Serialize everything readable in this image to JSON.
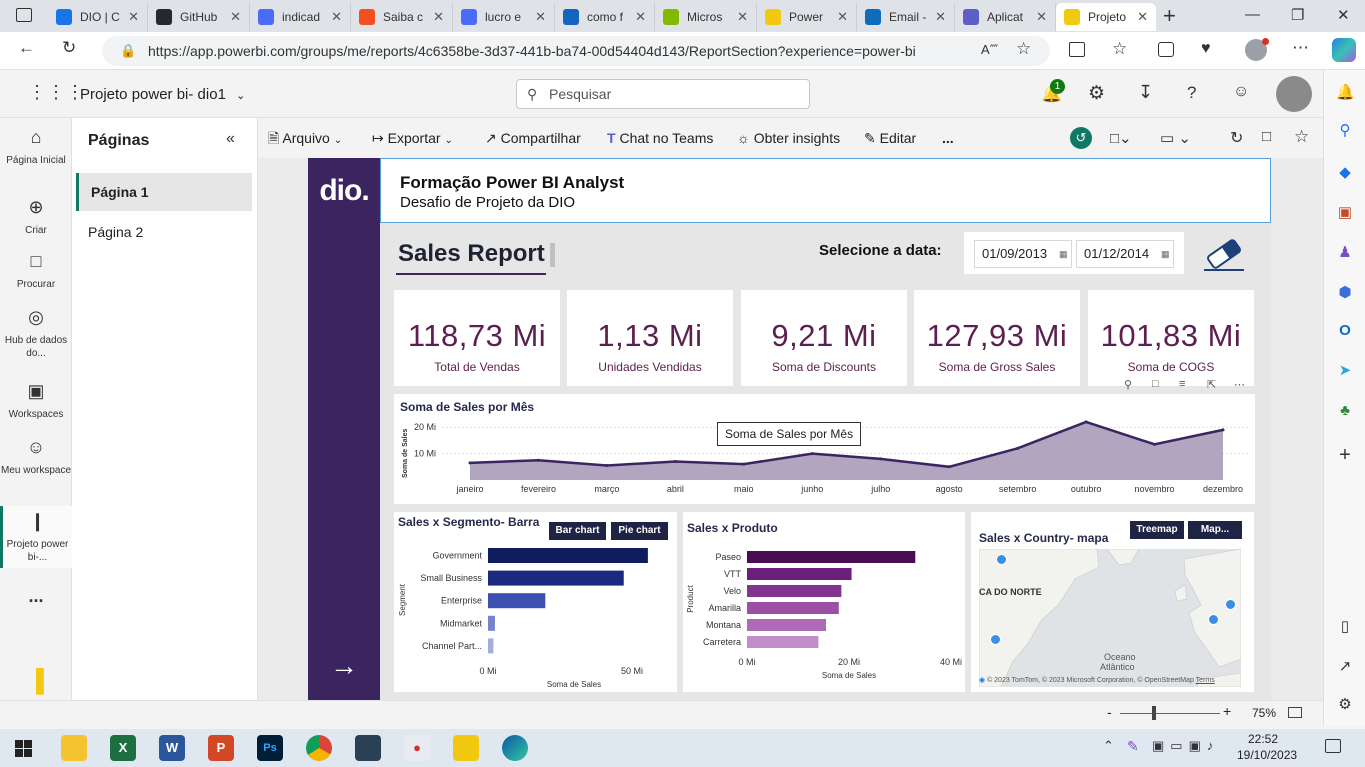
{
  "browser": {
    "tabs": [
      {
        "label": "DIO | C",
        "color": "#1a73e8"
      },
      {
        "label": "GitHub",
        "color": "#24292f"
      },
      {
        "label": "indicad",
        "color": "#4a6cf7"
      },
      {
        "label": "Saiba c",
        "color": "#f25022"
      },
      {
        "label": "lucro e",
        "color": "#4a6cf7"
      },
      {
        "label": "como f",
        "color": "#1565c0"
      },
      {
        "label": "Micros",
        "color": "#7fba00"
      },
      {
        "label": "Power",
        "color": "#f2c811"
      },
      {
        "label": "Email -",
        "color": "#0f6cbd"
      },
      {
        "label": "Aplicat",
        "color": "#5b5fc7"
      },
      {
        "label": "Projeto",
        "color": "#f2c811"
      }
    ],
    "url": "https://app.powerbi.com/groups/me/reports/4c6358be-3d37-441b-ba74-00d54404d143/ReportSection?experience=power-bi"
  },
  "pbi_header": {
    "workspace_title": "Projeto power bi- dio1",
    "search_placeholder": "Pesquisar",
    "notification_count": "1"
  },
  "left_nav": [
    {
      "label": "Página Inicial",
      "icon": "home-icon"
    },
    {
      "label": "Criar",
      "icon": "plus-circle-icon"
    },
    {
      "label": "Procurar",
      "icon": "folder-icon"
    },
    {
      "label": "Hub de dados do...",
      "icon": "data-hub-icon"
    },
    {
      "label": "Workspaces",
      "icon": "workspaces-icon"
    },
    {
      "label": "Meu workspace",
      "icon": "user-icon"
    },
    {
      "label": "Projeto power bi-...",
      "icon": "report-icon"
    },
    {
      "label": "...",
      "icon": "more-icon"
    },
    {
      "label": "Power BI",
      "icon": "powerbi-logo-icon"
    }
  ],
  "pages_pane": {
    "title": "Páginas",
    "pages": [
      "Página 1",
      "Página 2"
    ]
  },
  "toolbar": {
    "file": "Arquivo",
    "export": "Exportar",
    "share": "Compartilhar",
    "teams": "Chat no Teams",
    "insights": "Obter insights",
    "edit": "Editar",
    "more": "..."
  },
  "report": {
    "logo_text": "dio.",
    "header_title": "Formação Power BI Analyst",
    "header_subtitle": "Desafio de Projeto da DIO",
    "sales_report_title": "Sales Report",
    "date_label": "Selecione a data:",
    "date_from": "01/09/2013",
    "date_to": "01/12/2014",
    "kpis": [
      {
        "value": "118,73 Mi",
        "label": "Total de Vendas"
      },
      {
        "value": "1,13 Mi",
        "label": "Unidades Vendidas"
      },
      {
        "value": "9,21 Mi",
        "label": "Soma de Discounts"
      },
      {
        "value": "127,93 Mi",
        "label": "Soma de Gross Sales"
      },
      {
        "value": "101,83 Mi",
        "label": "Soma de COGS"
      }
    ],
    "monthly": {
      "title": "Soma de Sales por Mês",
      "tooltip": "Soma de  Sales por Mês",
      "ylabel": "Soma de Sales",
      "yticks": [
        "20 Mi",
        "10 Mi"
      ]
    },
    "segment": {
      "title": "Sales x Segmento- Barra",
      "btn_bar": "Bar chart",
      "btn_pie": "Pie chart",
      "xlabel": "Soma de Sales",
      "ylabel": "Segment",
      "xticks": [
        "0 Mi",
        "50 Mi"
      ]
    },
    "product": {
      "title": "Sales x Produto",
      "xlabel": "Soma de Sales",
      "ylabel": "Product",
      "xticks": [
        "0 Mi",
        "20 Mi",
        "40 Mi"
      ]
    },
    "map": {
      "title": "Sales x Country- mapa",
      "btn_treemap": "Treemap",
      "btn_map": "Map...",
      "label_na": "CA DO NORTE",
      "label_ocean": "Oceano",
      "label_ocean2": "Atlântico",
      "credit": "© 2023 TomTom, © 2023 Microsoft Corporation, © OpenStreetMap",
      "terms": "Terms"
    }
  },
  "chart_data": [
    {
      "type": "area",
      "title": "Soma de Sales por Mês",
      "categories": [
        "janeiro",
        "fevereiro",
        "março",
        "abril",
        "maio",
        "junho",
        "julho",
        "agosto",
        "setembro",
        "outubro",
        "novembro",
        "dezembro"
      ],
      "series": [
        {
          "values": [
            6.5,
            7.5,
            5.5,
            7.0,
            6.0,
            10.0,
            8.0,
            5.0,
            12.0,
            22.0,
            13.5,
            19.0
          ]
        }
      ],
      "ylabel": "Soma de Sales",
      "ylim": [
        0,
        25
      ],
      "color": "#3b2460",
      "fill": "#a89bb8"
    },
    {
      "type": "bar",
      "title": "Sales x Segmento- Barra",
      "categories": [
        "Government",
        "Small Business",
        "Enterprise",
        "Midmarket",
        "Channel Part..."
      ],
      "values": [
        53,
        45,
        19,
        2.3,
        1.8
      ],
      "colors": [
        "#0f1c5e",
        "#1a2a80",
        "#3d4fb0",
        "#7583cc",
        "#a3addc"
      ],
      "xlim": [
        0,
        60
      ]
    },
    {
      "type": "bar",
      "title": "Sales x Produto",
      "categories": [
        "Paseo",
        "VTT",
        "Velo",
        "Amarilla",
        "Montana",
        "Carretera"
      ],
      "values": [
        33,
        20.5,
        18.5,
        18,
        15.5,
        14
      ],
      "colors": [
        "#4a0d55",
        "#6b1f7a",
        "#83348f",
        "#9a4fa4",
        "#ad6bb6",
        "#c38ccb"
      ],
      "xlim": [
        0,
        40
      ]
    }
  ],
  "status": {
    "zoom": "75%",
    "time": "22:52",
    "date": "19/10/2023"
  }
}
